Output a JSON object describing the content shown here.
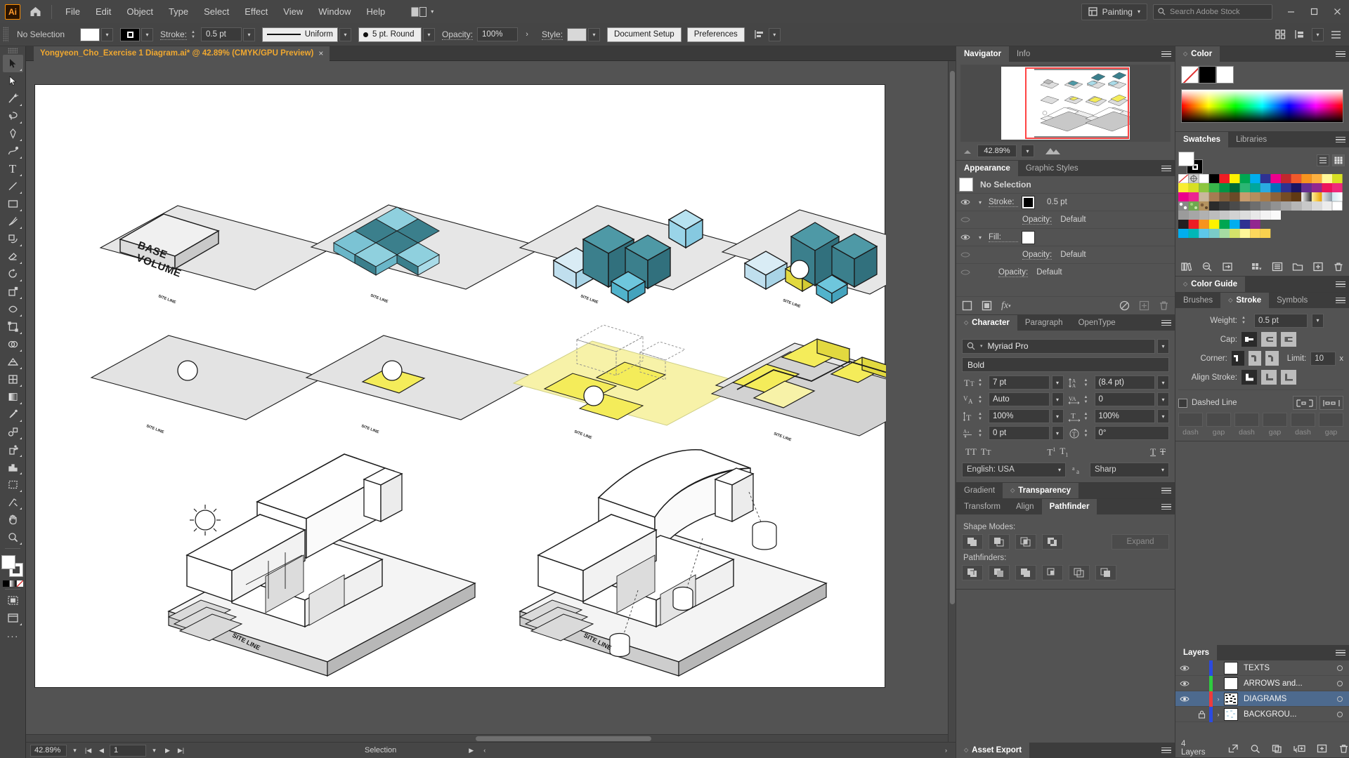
{
  "app": {
    "name": "Adobe Illustrator",
    "logo_text": "Ai",
    "home_icon": "home-icon"
  },
  "menubar": {
    "items": [
      "File",
      "Edit",
      "Object",
      "Type",
      "Select",
      "Effect",
      "View",
      "Window",
      "Help"
    ],
    "arrange_icon": "arrange-documents-icon",
    "workspace": "Painting",
    "search_placeholder": "Search Adobe Stock",
    "search_icon": "search-icon",
    "window_controls": [
      "minimize",
      "restore",
      "close"
    ]
  },
  "controlbar": {
    "selection_state": "No Selection",
    "fill_swatch_color": "#ffffff",
    "stroke_swatch_color": "#000000",
    "stroke_label": "Stroke:",
    "stroke_weight": "0.5 pt",
    "profile_label": "Uniform",
    "brush_label": "5 pt. Round",
    "opacity_label": "Opacity:",
    "opacity_value": "100%",
    "style_label": "Style:",
    "document_setup": "Document Setup",
    "preferences": "Preferences",
    "align_icon": "align-icon",
    "transform_icon": "transform-icon",
    "arrange_icon": "arrange-icon",
    "menu_icon": "hamburger-icon"
  },
  "toolbar": {
    "tools": [
      {
        "name": "selection-tool",
        "glyph": "arrow",
        "selected": true
      },
      {
        "name": "direct-selection-tool",
        "glyph": "arrow-white"
      },
      {
        "name": "magic-wand-tool",
        "glyph": "wand"
      },
      {
        "name": "lasso-tool",
        "glyph": "lasso"
      },
      {
        "name": "pen-tool",
        "glyph": "pen"
      },
      {
        "name": "curvature-tool",
        "glyph": "curvature"
      },
      {
        "name": "type-tool",
        "glyph": "T"
      },
      {
        "name": "line-segment-tool",
        "glyph": "line"
      },
      {
        "name": "rectangle-tool",
        "glyph": "rect"
      },
      {
        "name": "paintbrush-tool",
        "glyph": "brush"
      },
      {
        "name": "shaper-tool",
        "glyph": "shaper"
      },
      {
        "name": "eraser-tool",
        "glyph": "eraser"
      },
      {
        "name": "rotate-tool",
        "glyph": "rotate"
      },
      {
        "name": "scale-tool",
        "glyph": "scale"
      },
      {
        "name": "width-tool",
        "glyph": "width"
      },
      {
        "name": "free-transform-tool",
        "glyph": "freetransform"
      },
      {
        "name": "shape-builder-tool",
        "glyph": "shapebuilder"
      },
      {
        "name": "perspective-grid-tool",
        "glyph": "perspective"
      },
      {
        "name": "mesh-tool",
        "glyph": "mesh"
      },
      {
        "name": "gradient-tool",
        "glyph": "gradient"
      },
      {
        "name": "eyedropper-tool",
        "glyph": "eyedropper"
      },
      {
        "name": "blend-tool",
        "glyph": "blend"
      },
      {
        "name": "symbol-sprayer-tool",
        "glyph": "sprayer"
      },
      {
        "name": "column-graph-tool",
        "glyph": "graph"
      },
      {
        "name": "artboard-tool",
        "glyph": "artboard"
      },
      {
        "name": "slice-tool",
        "glyph": "slice"
      },
      {
        "name": "hand-tool",
        "glyph": "hand"
      },
      {
        "name": "zoom-tool",
        "glyph": "zoom"
      }
    ],
    "more_tools": "···",
    "fill_color": "#ffffff",
    "stroke_color": "#ffffff",
    "screen_mode_icon": "screen-mode-icon"
  },
  "document": {
    "tab_title": "Yongyeon_Cho_Exercise 1 Diagram.ai* @ 42.89% (CMYK/GPU Preview)",
    "close_glyph": "×"
  },
  "statusbar": {
    "zoom": "42.89%",
    "page": "1",
    "status_text": "Selection",
    "first_icon": "first-page-icon",
    "prev_icon": "prev-page-icon",
    "next_icon": "next-page-icon",
    "last_icon": "last-page-icon"
  },
  "navigator": {
    "tabs": [
      {
        "label": "Navigator",
        "active": true
      },
      {
        "label": "Info",
        "active": false
      }
    ],
    "zoom_value": "42.89%",
    "zoom_out_icon": "zoom-out-icon",
    "zoom_in_icon": "zoom-in-icon",
    "view_box_color": "#ff4343"
  },
  "appearance": {
    "tabs": [
      {
        "label": "Appearance",
        "active": true
      },
      {
        "label": "Graphic Styles",
        "active": false
      }
    ],
    "header": "No Selection",
    "rows": [
      {
        "name": "stroke-row",
        "label": "Stroke:",
        "value": "0.5 pt",
        "swatch": "#000000",
        "eye": true,
        "chevron": true
      },
      {
        "name": "stroke-opacity-row",
        "label": "Opacity:",
        "value": "Default",
        "eye": false,
        "indent": true
      },
      {
        "name": "fill-row",
        "label": "Fill:",
        "value": "",
        "swatch": "#ffffff",
        "eye": true,
        "chevron": true
      },
      {
        "name": "fill-opacity-row",
        "label": "Opacity:",
        "value": "Default",
        "eye": false,
        "indent": true
      },
      {
        "name": "object-opacity-row",
        "label": "Opacity:",
        "value": "Default",
        "eye": false
      }
    ],
    "footer_icons": [
      "add-new-stroke-icon",
      "add-new-fill-icon",
      "add-effect-icon",
      "clear-appearance-icon",
      "duplicate-item-icon",
      "delete-item-icon"
    ]
  },
  "character": {
    "tabs": [
      {
        "label": "Character",
        "active": true
      },
      {
        "label": "Paragraph",
        "active": false
      },
      {
        "label": "OpenType",
        "active": false
      }
    ],
    "font_family": "Myriad Pro",
    "font_style": "Bold",
    "font_size": "7 pt",
    "leading": "(8.4 pt)",
    "kerning": "Auto",
    "tracking": "0",
    "vertical_scale": "100%",
    "horizontal_scale": "100%",
    "baseline_shift": "0 pt",
    "rotation": "0°",
    "language": "English: USA",
    "anti_aliasing": "Sharp",
    "style_buttons": [
      "all-caps-icon",
      "small-caps-icon",
      "superscript-icon",
      "subscript-icon",
      "underline-icon",
      "strikethrough-icon"
    ],
    "icons": {
      "size": "font-size-icon",
      "leading": "leading-icon",
      "kerning": "kerning-icon",
      "tracking": "tracking-icon",
      "vscale": "vertical-scale-icon",
      "hscale": "horizontal-scale-icon",
      "baseline": "baseline-shift-icon",
      "rotate": "character-rotation-icon",
      "aa": "anti-aliasing-icon",
      "search": "search-icon"
    }
  },
  "transparency_group": {
    "tabs": [
      {
        "label": "Gradient",
        "active": false
      },
      {
        "label": "Transparency",
        "active": true
      }
    ]
  },
  "pathfinder": {
    "tabs": [
      {
        "label": "Transform",
        "active": false
      },
      {
        "label": "Align",
        "active": false
      },
      {
        "label": "Pathfinder",
        "active": true
      }
    ],
    "shape_modes_label": "Shape Modes:",
    "shape_modes": [
      "unite-icon",
      "minus-front-icon",
      "intersect-icon",
      "exclude-icon"
    ],
    "expand_label": "Expand",
    "pathfinders_label": "Pathfinders:",
    "pathfinders": [
      "divide-icon",
      "trim-icon",
      "merge-icon",
      "crop-icon",
      "outline-icon",
      "minus-back-icon"
    ]
  },
  "asset_export": {
    "title": "Asset Export"
  },
  "color": {
    "title": "Color",
    "swatches": [
      "none",
      "#000000",
      "#ffffff"
    ],
    "spectrum": "color-spectrum-ramp"
  },
  "swatches": {
    "tabs": [
      {
        "label": "Swatches",
        "active": true
      },
      {
        "label": "Libraries",
        "active": false
      }
    ],
    "fill_color": "#ffffff",
    "stroke_color": "#000000",
    "view_icons": [
      "list-view-icon",
      "grid-view-icon"
    ],
    "grid": [
      [
        "none",
        "registration",
        "#ffffff",
        "#000000",
        "#ed1c24",
        "#fff200",
        "#00a651",
        "#00aeef",
        "#2e3192",
        "#ec008c",
        "#c1272d",
        "#f1592a",
        "#f7941e",
        "#fbb040",
        "#fff799",
        "#d7df23"
      ],
      [
        "#f9ed32",
        "#d7df23",
        "#8dc63f",
        "#39b54a",
        "#009444",
        "#006838",
        "#2bb673",
        "#00a79d",
        "#29abe2",
        "#0071bc",
        "#2e3192",
        "#1b1464",
        "#662d91",
        "#92278f",
        "#ed145b",
        "#ee2a7b"
      ],
      [
        "#ec008c",
        "#ec2590",
        "#c9b79c",
        "#a67c52",
        "#754c24",
        "#603913",
        "#c69c6d",
        "#b58e5e",
        "#8c6239",
        "#754c24",
        "#603913",
        "#42210b",
        "#gradient-gray",
        "#gradient-gold",
        "#gradient-steel",
        "#gradient-fade"
      ],
      [
        "#pattern-dots",
        "#pattern-leaf",
        "#pattern-camo",
        "#444444",
        "#555555",
        "#666666",
        "#777777",
        "#888888",
        "#999999",
        "#aaaaaa",
        "#bbbbbb",
        "#cccccc",
        "#dddddd",
        "#eeeeee",
        "#f5f5f5",
        "#ffffff"
      ],
      [
        "#8a8a8a",
        "#999999",
        "#a5a5a5",
        "#b0b0b0",
        "#bcbcbc",
        "#c8c8c8",
        "#d4d4d4",
        "#e0e0e0",
        "#ececec",
        "#f4f4f4",
        "#fafafa",
        "#ffffff",
        "#ffffff",
        "#ffffff",
        "#ffffff",
        "#ffffff"
      ],
      [
        "#231f20",
        "#ed1c24",
        "#f7941e",
        "#fff200",
        "#00a651",
        "#00aeef",
        "#2e3192",
        "#92278f",
        "#cccccc",
        "#dddddd",
        "#eeeeee",
        "#ffffff",
        "#ffffff",
        "#ffffff",
        "#ffffff",
        "#ffffff"
      ],
      [
        "#00aeef",
        "#00b7b7",
        "#5dc8ea",
        "#7accc8",
        "#a6dca3",
        "#d4e36a",
        "#fff799",
        "#fdd85d",
        "#f8d14f",
        "#ffe79a",
        "#ffffff",
        "#ffffff",
        "#ffffff",
        "#ffffff",
        "#ffffff",
        "#ffffff"
      ]
    ],
    "footer_icons": [
      "swatch-libraries-icon",
      "show-libraries-icon",
      "add-to-library-icon",
      "color-group-icon",
      "swatch-options-icon",
      "new-color-group-icon",
      "new-swatch-icon",
      "delete-swatch-icon"
    ]
  },
  "color_guide": {
    "title": "Color Guide"
  },
  "stroke": {
    "tabs": [
      {
        "label": "Brushes",
        "active": false
      },
      {
        "label": "Stroke",
        "active": true
      },
      {
        "label": "Symbols",
        "active": false
      }
    ],
    "weight_label": "Weight:",
    "weight_value": "0.5 pt",
    "cap_label": "Cap:",
    "cap_selected": 0,
    "corner_label": "Corner:",
    "corner_selected": 0,
    "limit_label": "Limit:",
    "limit_value": "10",
    "limit_unit": "x",
    "align_label": "Align Stroke:",
    "align_selected": 0,
    "dashed_label": "Dashed Line",
    "dashed_checked": false,
    "dash_fields": [
      "dash",
      "gap",
      "dash",
      "gap",
      "dash",
      "gap"
    ]
  },
  "layers": {
    "title": "Layers",
    "rows": [
      {
        "name": "TEXTS",
        "color": "#2b4ae0",
        "visible": true,
        "locked": false,
        "expandable": false,
        "selected": false,
        "thumb": "blank"
      },
      {
        "name": "ARROWS and...",
        "color": "#2ecc3f",
        "visible": true,
        "locked": false,
        "expandable": false,
        "selected": false,
        "thumb": "blank"
      },
      {
        "name": "DIAGRAMS",
        "color": "#ef3b3b",
        "visible": true,
        "locked": false,
        "expandable": true,
        "selected": true,
        "thumb": "diagram"
      },
      {
        "name": "BACKGROU...",
        "color": "#2b4ae0",
        "visible": false,
        "locked": true,
        "expandable": true,
        "selected": false,
        "thumb": "background"
      }
    ],
    "count_label": "4 Layers",
    "footer_icons": [
      "release-to-layers-icon",
      "locate-object-icon",
      "make-clipping-mask-icon",
      "create-new-sublayer-icon",
      "create-new-layer-icon",
      "delete-selection-icon"
    ]
  },
  "artwork": {
    "labels": {
      "base_volume": "BASE VOLUME",
      "site_line": "SITE LINE"
    },
    "colors": {
      "teal_dark": "#3b7f8c",
      "teal_mid": "#4e99a6",
      "teal_light": "#a9dbe8",
      "cyan": "#62c8dd",
      "yellow": "#f4ec5a",
      "yellow_light": "#f7f2a8",
      "gray_fill": "#e3e3e3",
      "gray_mid": "#cfcfcf",
      "gray_dark": "#a8a8a8",
      "outline": "#1a1a1a"
    },
    "row_count": 3,
    "diagram_count": 10
  }
}
